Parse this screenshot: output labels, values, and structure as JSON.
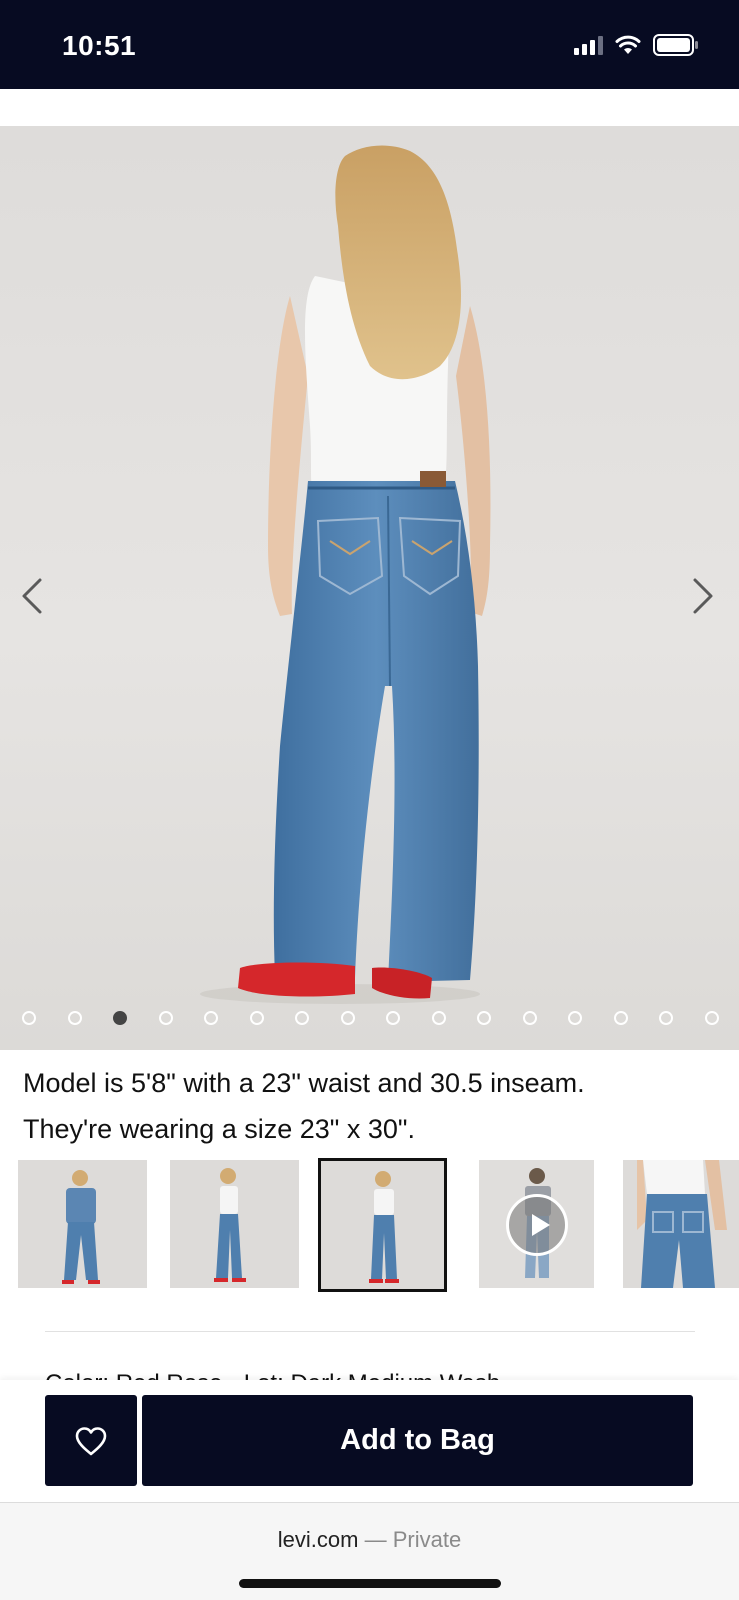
{
  "status_bar": {
    "time": "10:51"
  },
  "gallery": {
    "total_images": 16,
    "active_index": 2,
    "prev_icon": "chevron-left-icon",
    "next_icon": "chevron-right-icon"
  },
  "caption": {
    "line1": "Model is 5'8\" with a 23\" waist and 30.5 inseam.",
    "line2": "They're wearing a size 23\" x 30\"."
  },
  "thumbnails": {
    "selected_index": 2,
    "video_index": 3,
    "play_icon": "play-icon"
  },
  "product_details": {
    "partial_text": "Color: Red Rose · Lot: Dark Medium Wash"
  },
  "actions": {
    "wishlist_icon": "heart-icon",
    "add_to_bag_label": "Add to Bag"
  },
  "browser": {
    "domain": "levi.com",
    "separator": "—",
    "mode": "Private"
  },
  "colors": {
    "primary_navy": "#070b22",
    "denim": "#4f7fae",
    "shoe_red": "#d5272b"
  }
}
